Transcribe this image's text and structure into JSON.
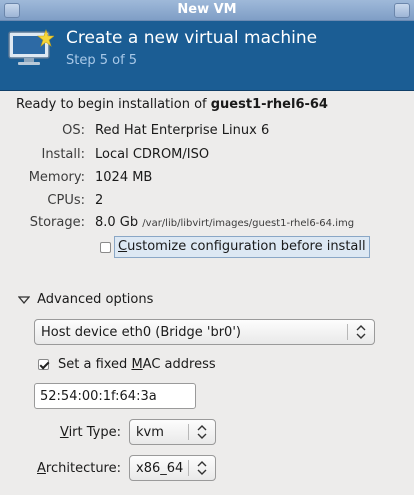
{
  "window": {
    "title": "New VM"
  },
  "header": {
    "title": "Create a new virtual machine",
    "step": "Step 5 of 5"
  },
  "summary": {
    "ready_prefix": "Ready to begin installation of ",
    "vm_name": "guest1-rhel6-64",
    "os_label": "OS:",
    "os_value": "Red Hat Enterprise Linux 6",
    "install_label": "Install:",
    "install_value": "Local CDROM/ISO",
    "memory_label": "Memory:",
    "memory_value": "1024 MB",
    "cpus_label": "CPUs:",
    "cpus_value": "2",
    "storage_label": "Storage:",
    "storage_value": "8.0 Gb",
    "storage_path": "/var/lib/libvirt/images/guest1-rhel6-64.img"
  },
  "customize": {
    "label_accel": "C",
    "label_rest": "ustomize configuration before install",
    "checked": false
  },
  "advanced": {
    "label": "Advanced options",
    "network_value": "Host device eth0 (Bridge 'br0')",
    "mac_label_pre": "Set a fixed ",
    "mac_label_accel": "M",
    "mac_label_post": "AC address",
    "mac_checked": true,
    "mac_value": "52:54:00:1f:64:3a",
    "virt_type_label_accel": "V",
    "virt_type_label_rest": "irt Type:",
    "virt_type_value": "kvm",
    "arch_label_accel": "A",
    "arch_label_rest": "rchitecture:",
    "arch_value": "x86_64"
  },
  "colors": {
    "header_bg": "#1b5d94",
    "titlebar": "#8ea9cf",
    "window_bg": "#edeceb"
  }
}
